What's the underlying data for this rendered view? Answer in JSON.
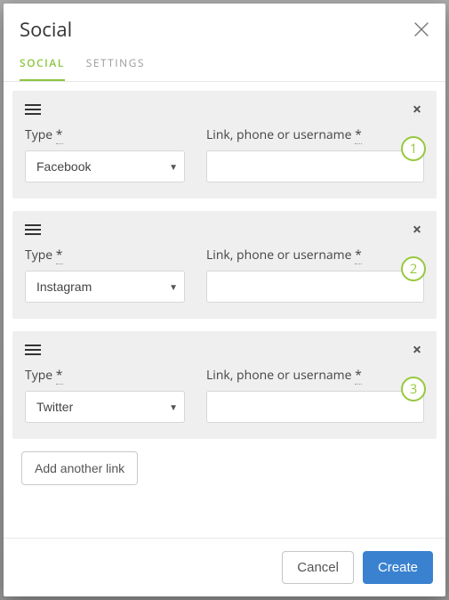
{
  "modal": {
    "title": "Social"
  },
  "tabs": {
    "social": "SOCIAL",
    "settings": "SETTINGS"
  },
  "labels": {
    "type": "Type",
    "link": "Link, phone or username",
    "required_mark": "*"
  },
  "rows": [
    {
      "badge": "1",
      "type": "Facebook",
      "value": ""
    },
    {
      "badge": "2",
      "type": "Instagram",
      "value": ""
    },
    {
      "badge": "3",
      "type": "Twitter",
      "value": ""
    }
  ],
  "buttons": {
    "add_link": "Add another link",
    "cancel": "Cancel",
    "create": "Create"
  }
}
